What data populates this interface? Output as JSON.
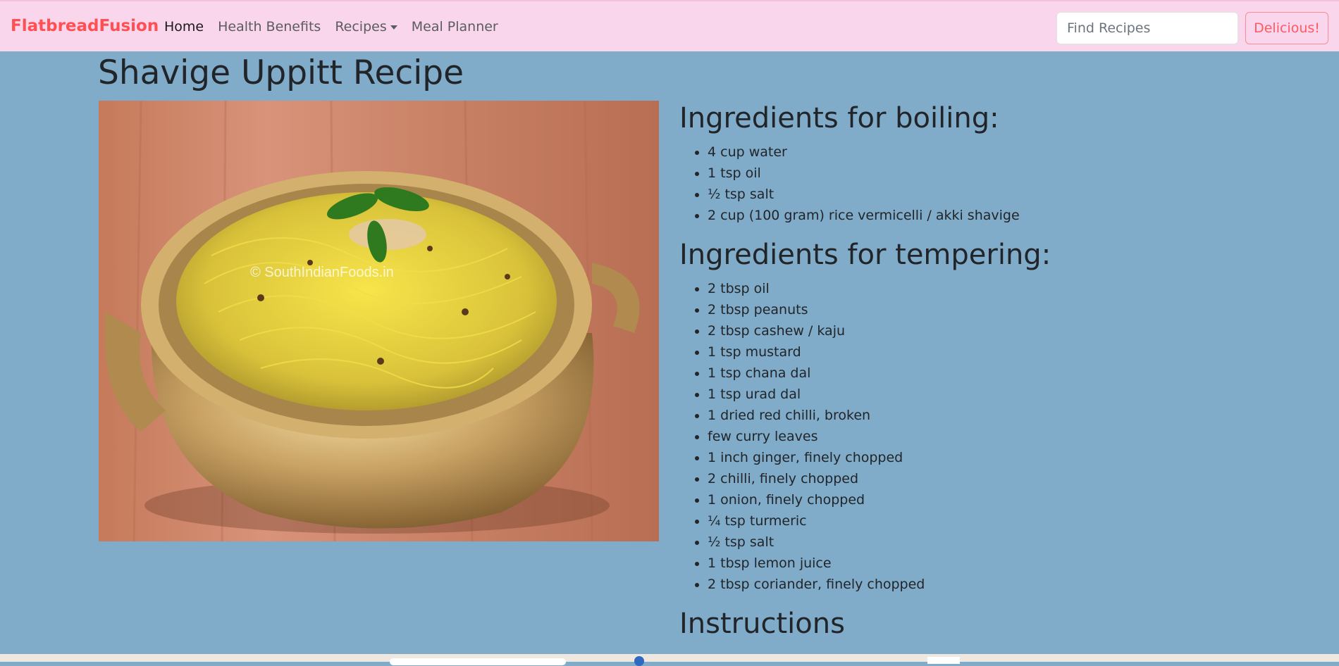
{
  "navbar": {
    "brand": "FlatbreadFusion",
    "links": [
      {
        "label": "Home"
      },
      {
        "label": "Health Benefits"
      },
      {
        "label": "Recipes"
      },
      {
        "label": "Meal Planner"
      }
    ],
    "search_placeholder": "Find Recipes",
    "search_value": "",
    "button_label": "Delicious!"
  },
  "page": {
    "title": "Shavige Uppitt Recipe",
    "image_watermark": "© SouthIndianFoods.in"
  },
  "sections": {
    "boiling": {
      "heading": "Ingredients for boiling:",
      "items": [
        "4 cup water",
        "1 tsp oil",
        "½ tsp salt",
        "2 cup (100 gram) rice vermicelli / akki shavige"
      ]
    },
    "tempering": {
      "heading": "Ingredients for tempering:",
      "items": [
        "2 tbsp oil",
        "2 tbsp peanuts",
        "2 tbsp cashew / kaju",
        "1 tsp mustard",
        "1 tsp chana dal",
        "1 tsp urad dal",
        "1 dried red chilli, broken",
        "few curry leaves",
        "1 inch ginger, finely chopped",
        "2 chilli, finely chopped",
        "1 onion, finely chopped",
        "¼ tsp turmeric",
        "½ tsp salt",
        "1 tbsp lemon juice",
        "2 tbsp coriander, finely chopped"
      ]
    },
    "instructions": {
      "heading": "Instructions"
    }
  },
  "colors": {
    "navbar_bg": "#fad6ec",
    "page_bg": "#80acc9",
    "brand": "#ff4f52",
    "button_border": "#ff8a96"
  }
}
